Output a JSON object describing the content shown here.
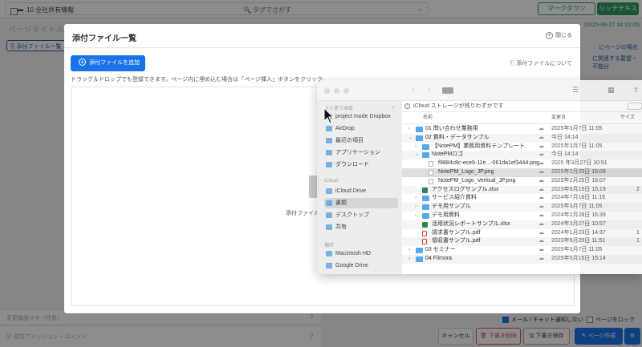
{
  "header": {
    "folder_icon": "▬",
    "folder_label": "10 全社共有情報",
    "search_placeholder": "🔍 タグでさがす",
    "mode_markdown": "マークダウン",
    "mode_richtext": "リッチテキスト"
  },
  "editor": {
    "title_placeholder": "ページタイトル",
    "attach_button": "⎘ 添付ファイル一覧",
    "right_date": "(2025-08-27 14:10:25)",
    "right_link_1": "にページの場合",
    "right_link_2": "に関連する要望・不能分",
    "tags_placeholder": "変更履歴メモ（任意）",
    "message_placeholder": "＠ 名前でメンション・コメント",
    "opt_notify": "メール / チャット通知しない",
    "opt_lock": "ページをロック",
    "btn_cancel": "キャンセル",
    "btn_delete": "🗑 下書き削除",
    "btn_draft": "🖫 下書き保存",
    "btn_publish": "✎ ページ作成",
    "btn_gear": "⚙"
  },
  "modal": {
    "title": "添付ファイル一覧",
    "close_label": "閉じる",
    "close_icon": "+",
    "add_button": "添付ファイルを追加",
    "add_icon": "+",
    "about_link": "ⓘ 添付ファイルについて",
    "hint": "ドラッグ＆ドロップでも登録できます。ページ内に埋め込む場合は「ページ挿入」ボタンをクリック。",
    "dropzone_label": "添付ファイル"
  },
  "finder": {
    "nav_back": "‹",
    "nav_forward": "›",
    "view_icon": "☰",
    "grid_icon": "▦",
    "share_icon": "⇧",
    "sidebar_sections": {
      "favorites": "よく使う項目",
      "icloud": "iCloud",
      "locations": "場所"
    },
    "sidebar_items": [
      {
        "label": "project mode Dropbox"
      },
      {
        "label": "AirDrop"
      },
      {
        "label": "最近の項目"
      },
      {
        "label": "アプリケーション"
      },
      {
        "label": "ダウンロード"
      },
      {
        "label": "iCloud Drive"
      },
      {
        "label": "書類"
      },
      {
        "label": "デスクトップ"
      },
      {
        "label": "共有"
      },
      {
        "label": "Macintosh HD"
      },
      {
        "label": "Google Drive"
      }
    ],
    "icloud_notice": "iCloud ストレージが残りわずかです",
    "columns": {
      "name": "名前",
      "modified": "変更日",
      "size": "サイズ"
    },
    "rows": [
      {
        "toggle": "›",
        "type": "folder",
        "name": "01 問い合わせ業務用",
        "date": "2025年3月7日 11:05",
        "size": ""
      },
      {
        "toggle": "⌄",
        "type": "folder",
        "name": "02 資料・データサンプル",
        "date": "今日 14:14",
        "size": ""
      },
      {
        "toggle": "›",
        "type": "folder",
        "name": "【NotePM】業務用資料テンプレート",
        "date": "2025年3月7日 11:05",
        "size": ""
      },
      {
        "toggle": "⌄",
        "type": "folder",
        "name": "NotePMロゴ",
        "date": "今日 14:14",
        "size": ""
      },
      {
        "toggle": "",
        "type": "png",
        "name": "f9884c8c-ece9-11e...-061da1ef3444.png",
        "date": "2025 年3月27日 10:51",
        "size": ""
      },
      {
        "toggle": "",
        "type": "png",
        "name": "NotePM_Logo_JP.png",
        "date": "2025年2月25日 16:08",
        "size": ""
      },
      {
        "toggle": "",
        "type": "png",
        "name": "NotePM_Logo_Vertical_JP.png",
        "date": "2025年2月25日 16:07",
        "size": ""
      },
      {
        "toggle": "",
        "type": "xlsx",
        "name": "アクセスログサンプル.xlsx",
        "date": "2023年9月15日 15:19",
        "size": "2"
      },
      {
        "toggle": "›",
        "type": "folder",
        "name": "サービス紹介資料",
        "date": "2024年7月16日 11:16",
        "size": ""
      },
      {
        "toggle": "›",
        "type": "folder",
        "name": "デモ用サンプル",
        "date": "2025年3月7日 11:05",
        "size": ""
      },
      {
        "toggle": "›",
        "type": "folder",
        "name": "デモ用資料",
        "date": "2024年2月28日 16:39",
        "size": ""
      },
      {
        "toggle": "",
        "type": "xlsx",
        "name": "活用状況レポートサンプル.xlsx",
        "date": "2024年3月27日 10:57",
        "size": ""
      },
      {
        "toggle": "",
        "type": "pdf",
        "name": "請求書サンプル.pdf",
        "date": "2024年1月23日 14:37",
        "size": "1"
      },
      {
        "toggle": "",
        "type": "pdf",
        "name": "領収書サンプル.pdf",
        "date": "2023年9月20日 11:51",
        "size": "1"
      },
      {
        "toggle": "›",
        "type": "folder",
        "name": "03 セミナー",
        "date": "2025年3月7日 11:05",
        "size": ""
      },
      {
        "toggle": "›",
        "type": "folder",
        "name": "04 Filmora",
        "date": "2025年5月15日 15:14",
        "size": ""
      }
    ]
  },
  "colors": {
    "accent": "#1a73e8",
    "brand_green": "#2e9d63",
    "danger": "#d9534f"
  }
}
